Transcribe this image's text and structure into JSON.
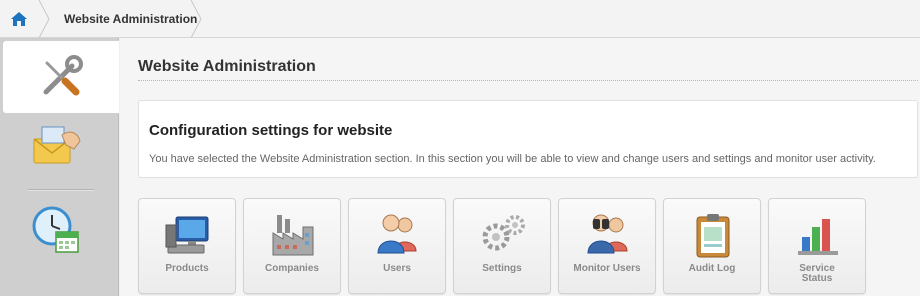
{
  "breadcrumb": {
    "home_icon": "home-icon",
    "current": "Website Administration"
  },
  "rail": {
    "tabs": [
      {
        "name": "administration",
        "icon": "tools-icon",
        "active": true
      },
      {
        "name": "messages",
        "icon": "mail-icon",
        "active": false
      },
      {
        "name": "schedule",
        "icon": "clock-calendar-icon",
        "active": false
      }
    ]
  },
  "main": {
    "title": "Website Administration",
    "card": {
      "heading": "Configuration settings for website",
      "text": "You have selected the Website Administration section. In this section you will be able to view and change users and settings and monitor user activity."
    },
    "tiles": [
      {
        "label": "Products",
        "icon": "monitor-icon"
      },
      {
        "label": "Companies",
        "icon": "factory-icon"
      },
      {
        "label": "Users",
        "icon": "users-icon"
      },
      {
        "label": "Settings",
        "icon": "gears-icon"
      },
      {
        "label": "Monitor Users",
        "icon": "binoculars-users-icon"
      },
      {
        "label": "Audit Log",
        "icon": "clipboard-icon"
      },
      {
        "label": "Service Status",
        "icon": "bar-chart-icon"
      }
    ]
  },
  "colors": {
    "accent_blue": "#1e73be",
    "tile_label": "#8a8a8a",
    "rail_bg": "#cfcfcf"
  }
}
